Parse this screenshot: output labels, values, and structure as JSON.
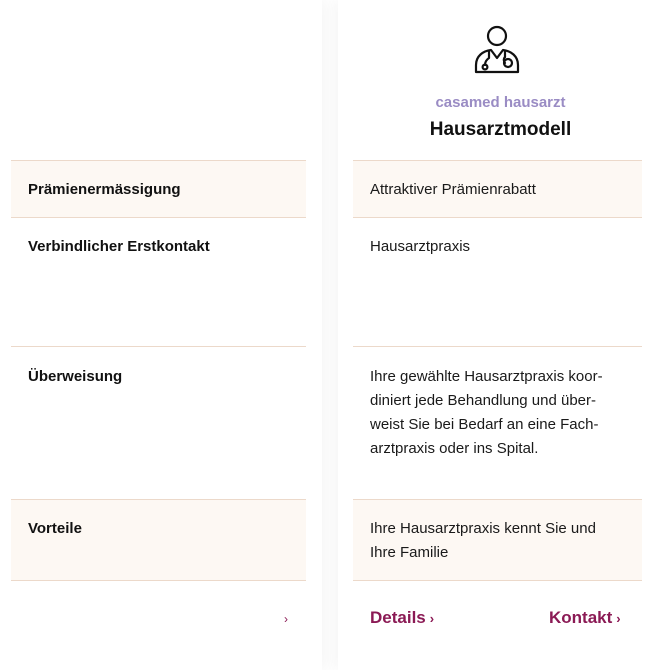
{
  "plan": {
    "brand": "casamed hausarzt",
    "title": "Hausarztmodell",
    "icon": "doctor-icon"
  },
  "rows": [
    {
      "label": "Prämienermässigung",
      "value": "Attraktiver Prämienrabatt"
    },
    {
      "label": "Verbindlicher Erstkontakt",
      "value": "Hausarztpraxis"
    },
    {
      "label": "Überweisung",
      "value_lines": [
        "Ihre gewählte Hausarztpraxis koor-",
        "diniert jede Behandlung und über-",
        "weist Sie bei Bedarf an eine Fach-",
        "arztpraxis oder ins Spital."
      ]
    },
    {
      "label": "Vorteile",
      "value_lines": [
        "Ihre Hausarztpraxis kennt Sie und",
        "Ihre Familie"
      ]
    }
  ],
  "footer": {
    "left_chevron": "›",
    "details_label": "Details",
    "contact_label": "Kontakt",
    "chevron": "›"
  },
  "colors": {
    "accent": "#8b1a55",
    "brand": "#9a8cc4",
    "row_tint": "#fdf8f3",
    "divider": "#ecd9ca"
  }
}
